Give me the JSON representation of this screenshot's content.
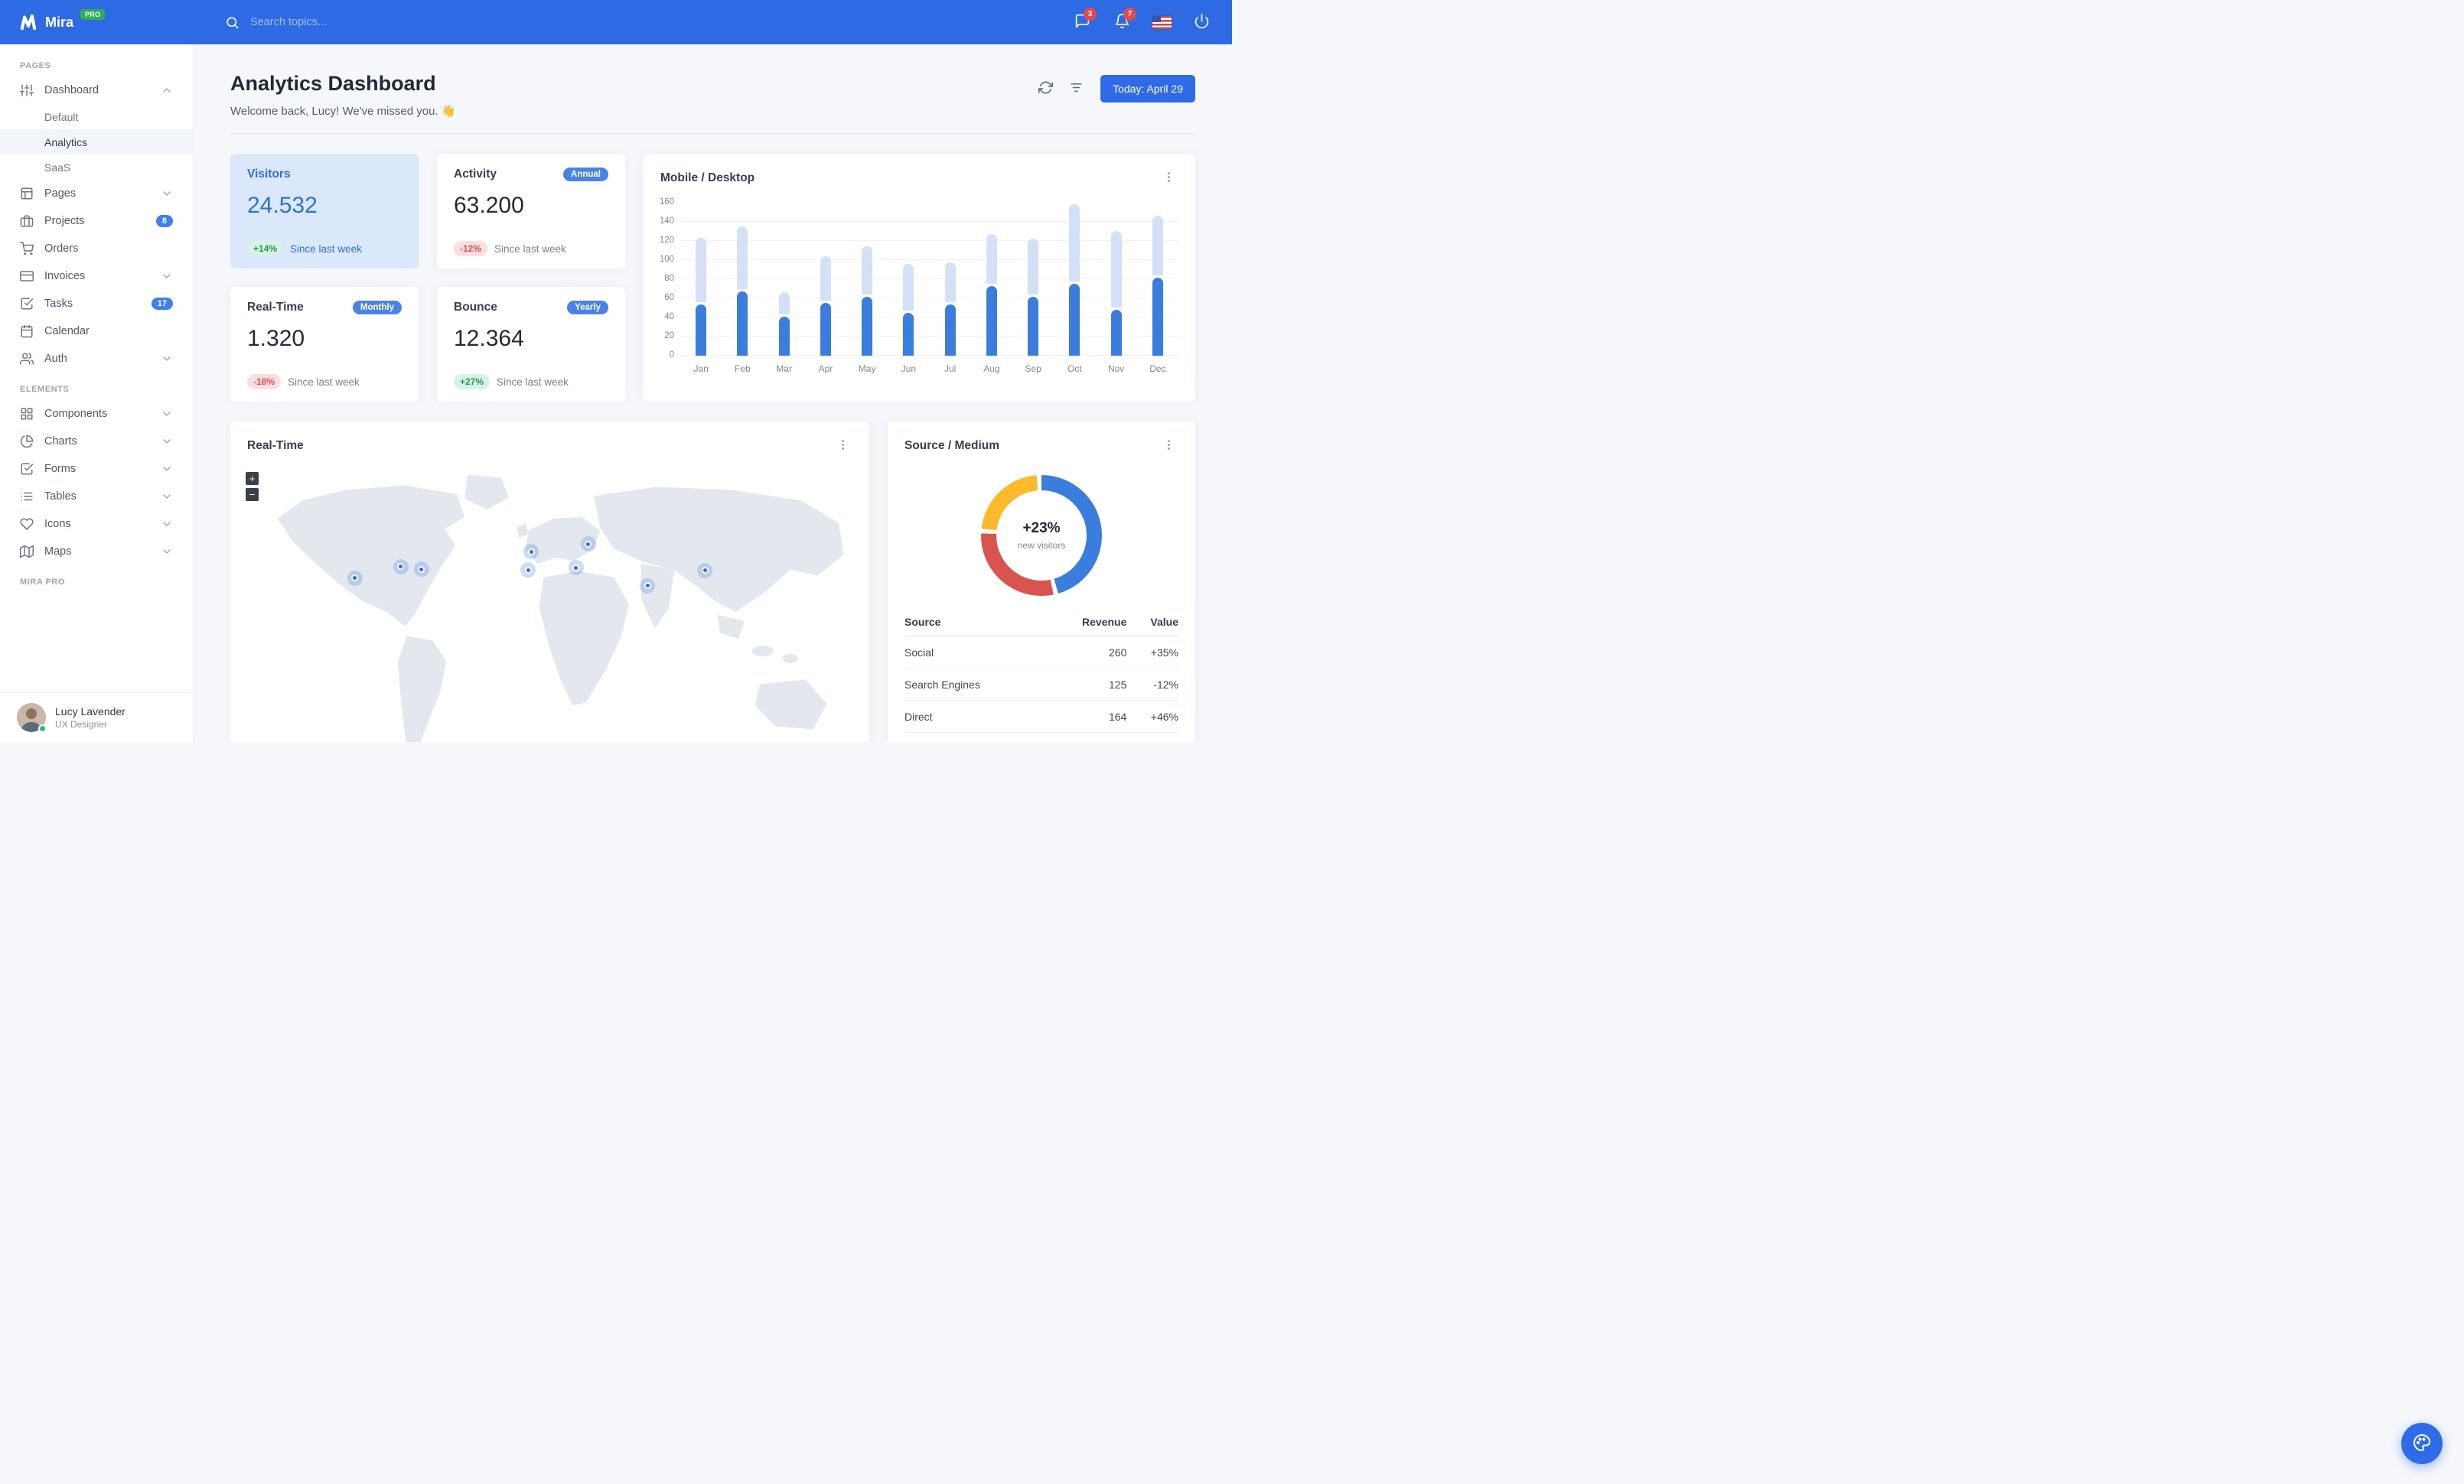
{
  "navbar": {
    "brand": "Mira",
    "brand_badge": "PRO",
    "search_placeholder": "Search topics...",
    "messages_badge": "3",
    "notifications_badge": "7"
  },
  "sidebar": {
    "sections": [
      {
        "label": "Pages",
        "items": [
          {
            "label": "Dashboard",
            "icon": "sliders",
            "chevron": "up",
            "children": [
              {
                "label": "Default",
                "active": false
              },
              {
                "label": "Analytics",
                "active": true
              },
              {
                "label": "SaaS",
                "active": false
              }
            ]
          },
          {
            "label": "Pages",
            "icon": "layout",
            "chevron": "down"
          },
          {
            "label": "Projects",
            "icon": "briefcase",
            "badge": "8"
          },
          {
            "label": "Orders",
            "icon": "shopping-cart"
          },
          {
            "label": "Invoices",
            "icon": "credit-card",
            "chevron": "down"
          },
          {
            "label": "Tasks",
            "icon": "check-square",
            "badge": "17"
          },
          {
            "label": "Calendar",
            "icon": "calendar"
          },
          {
            "label": "Auth",
            "icon": "users",
            "chevron": "down"
          }
        ]
      },
      {
        "label": "Elements",
        "items": [
          {
            "label": "Components",
            "icon": "grid",
            "chevron": "down"
          },
          {
            "label": "Charts",
            "icon": "pie-chart",
            "chevron": "down"
          },
          {
            "label": "Forms",
            "icon": "check-square",
            "chevron": "down"
          },
          {
            "label": "Tables",
            "icon": "list",
            "chevron": "down"
          },
          {
            "label": "Icons",
            "icon": "heart",
            "chevron": "down"
          },
          {
            "label": "Maps",
            "icon": "map",
            "chevron": "down"
          }
        ]
      },
      {
        "label": "Mira Pro",
        "items": []
      }
    ],
    "user": {
      "name": "Lucy Lavender",
      "role": "UX Designer"
    }
  },
  "header": {
    "title": "Analytics Dashboard",
    "subtitle": "Welcome back, Lucy! We've missed you. 👋",
    "date_button": "Today: April 29"
  },
  "stats": [
    {
      "title": "Visitors",
      "badge": null,
      "value": "24.532",
      "delta": "+14%",
      "delta_type": "positive",
      "caption": "Since last week",
      "highlight": true
    },
    {
      "title": "Activity",
      "badge": "Annual",
      "value": "63.200",
      "delta": "-12%",
      "delta_type": "negative",
      "caption": "Since last week",
      "highlight": false
    },
    {
      "title": "Real-Time",
      "badge": "Monthly",
      "value": "1.320",
      "delta": "-18%",
      "delta_type": "negative",
      "caption": "Since last week",
      "highlight": false
    },
    {
      "title": "Bounce",
      "badge": "Yearly",
      "value": "12.364",
      "delta": "+27%",
      "delta_type": "positive",
      "caption": "Since last week",
      "highlight": false
    }
  ],
  "chart_data": [
    {
      "type": "bar",
      "stacked": true,
      "title": "Mobile / Desktop",
      "categories": [
        "Jan",
        "Feb",
        "Mar",
        "Apr",
        "May",
        "Jun",
        "Jul",
        "Aug",
        "Sep",
        "Oct",
        "Nov",
        "Dec"
      ],
      "series": [
        {
          "name": "Mobile",
          "color": "#3b7ddd",
          "values": [
            54,
            67,
            41,
            55,
            62,
            45,
            54,
            73,
            62,
            75,
            48,
            82
          ]
        },
        {
          "name": "Desktop",
          "color": "#d3e0f5",
          "values": [
            67,
            66,
            23,
            47,
            50,
            49,
            41,
            52,
            58,
            81,
            80,
            62
          ]
        }
      ],
      "ylim": [
        0,
        160
      ],
      "yticks": [
        0,
        20,
        40,
        60,
        80,
        100,
        120,
        140,
        160
      ],
      "grid": true,
      "legend": "none"
    },
    {
      "type": "pie",
      "title": "Source / Medium",
      "center_label": "+23%",
      "center_sublabel": "new visitors",
      "slices": [
        {
          "label": "Social",
          "value": 260,
          "color": "#3b7ddd"
        },
        {
          "label": "Direct",
          "value": 164,
          "color": "#d9534f"
        },
        {
          "label": "Search Engines",
          "value": 125,
          "color": "#fcb92c"
        }
      ]
    }
  ],
  "map_card": {
    "title": "Real-Time",
    "zoom_in": "+",
    "zoom_out": "−",
    "markers": [
      {
        "x": 19.5,
        "y": 39.8
      },
      {
        "x": 26.7,
        "y": 35.7
      },
      {
        "x": 29.9,
        "y": 36.7
      },
      {
        "x": 46.6,
        "y": 36.9
      },
      {
        "x": 47.1,
        "y": 30.5
      },
      {
        "x": 56.0,
        "y": 27.9
      },
      {
        "x": 54.1,
        "y": 36.2
      },
      {
        "x": 65.3,
        "y": 42.4
      },
      {
        "x": 74.3,
        "y": 37.1
      }
    ]
  },
  "source_table": {
    "columns": [
      "Source",
      "Revenue",
      "Value"
    ],
    "rows": [
      {
        "source": "Social",
        "revenue": "260",
        "value": "+35%",
        "type": "positive"
      },
      {
        "source": "Search Engines",
        "revenue": "125",
        "value": "-12%",
        "type": "negative"
      },
      {
        "source": "Direct",
        "revenue": "164",
        "value": "+46%",
        "type": "positive"
      }
    ]
  },
  "colors": {
    "navbar": "#2d6ae3",
    "primary": "#2f6be6",
    "success": "#1f9d58",
    "danger": "#e04f50",
    "warning": "#fcb92c",
    "bar_light": "#d3e0f5"
  }
}
